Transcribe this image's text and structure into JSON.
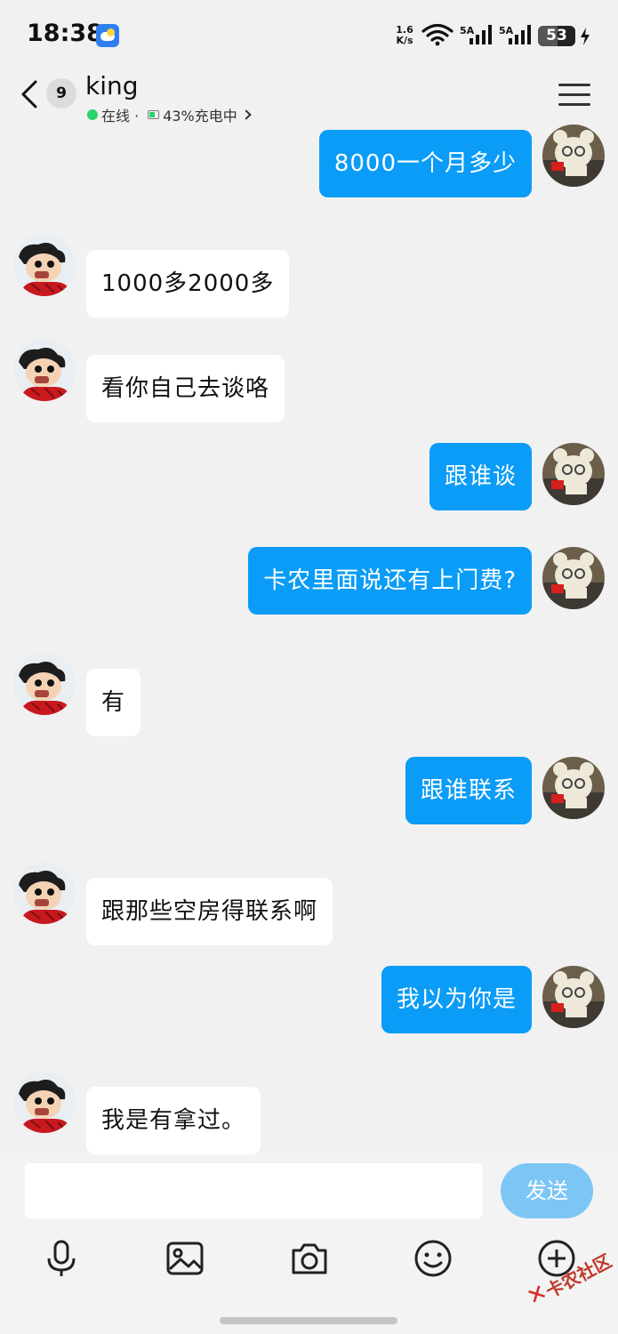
{
  "status_bar": {
    "time": "18:38",
    "net_speed_value": "1.6",
    "net_speed_unit": "K/s",
    "sim1_label": "5A",
    "sim2_label": "5A",
    "battery_level": "53",
    "battery_fraction": 0.53
  },
  "header": {
    "unread_count": "9",
    "contact_name": "king",
    "presence": "在线 · ",
    "device_status": "43%充电中"
  },
  "messages": [
    {
      "dir": "out",
      "text": "8000一个月多少"
    },
    {
      "dir": "in",
      "text": "1000多2000多"
    },
    {
      "dir": "in",
      "text": "看你自己去谈咯"
    },
    {
      "dir": "out",
      "text": "跟谁谈"
    },
    {
      "dir": "out",
      "text": "卡农里面说还有上门费?"
    },
    {
      "dir": "in",
      "text": "有"
    },
    {
      "dir": "out",
      "text": "跟谁联系"
    },
    {
      "dir": "in",
      "text": "跟那些空房得联系啊"
    },
    {
      "dir": "out",
      "text": "我以为你是"
    },
    {
      "dir": "in",
      "text": "我是有拿过。"
    }
  ],
  "composer": {
    "input_value": "",
    "send_label": "发送"
  },
  "toolbar_icons": [
    "microphone-icon",
    "image-icon",
    "camera-icon",
    "emoji-icon",
    "plus-icon"
  ],
  "watermark": "卡农社区",
  "colors": {
    "outgoing_bubble": "#0a9cf7",
    "incoming_bubble": "#ffffff",
    "send_button": "#7cc6f6",
    "online": "#2bd36b"
  }
}
